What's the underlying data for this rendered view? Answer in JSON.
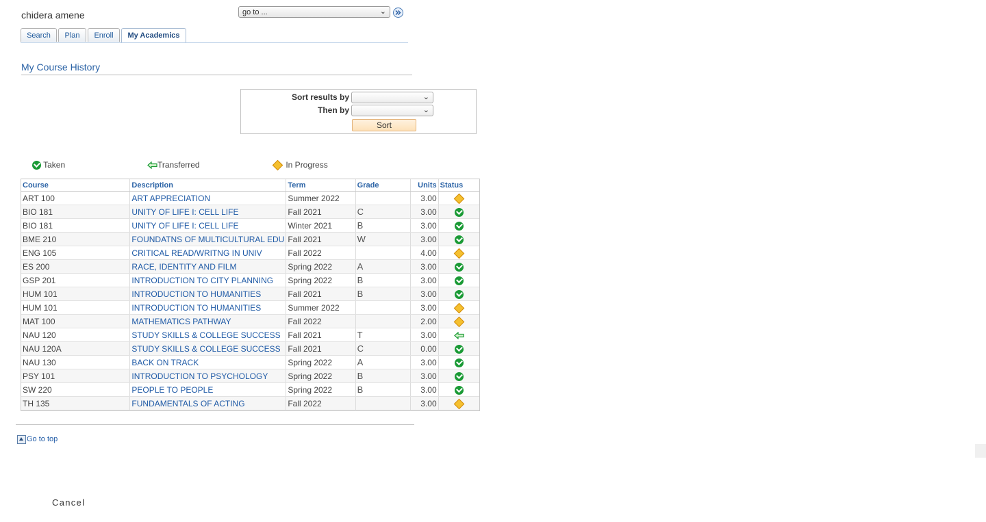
{
  "header": {
    "student_name": "chidera amene",
    "goto_select": "go to ..."
  },
  "tabs": [
    {
      "label": "Search",
      "active": false
    },
    {
      "label": "Plan",
      "active": false
    },
    {
      "label": "Enroll",
      "active": false
    },
    {
      "label": "My Academics",
      "active": true
    }
  ],
  "page_title": "My Course History",
  "sort": {
    "sort_label": "Sort results by",
    "then_label": "Then by",
    "sort_value": "",
    "then_value": "",
    "button_label": "Sort"
  },
  "legend": {
    "taken": "Taken",
    "transferred": "Transferred",
    "in_progress": "In Progress"
  },
  "table": {
    "headers": {
      "course": "Course",
      "description": "Description",
      "term": "Term",
      "grade": "Grade",
      "units": "Units",
      "status": "Status"
    },
    "rows": [
      {
        "course": "ART 100",
        "description": "ART APPRECIATION",
        "term": "Summer 2022",
        "grade": "",
        "units": "3.00",
        "status": "in-progress"
      },
      {
        "course": "BIO 181",
        "description": "UNITY OF LIFE I: CELL LIFE",
        "term": "Fall 2021",
        "grade": "C",
        "units": "3.00",
        "status": "taken"
      },
      {
        "course": "BIO 181",
        "description": "UNITY OF LIFE I: CELL LIFE",
        "term": "Winter 2021",
        "grade": "B",
        "units": "3.00",
        "status": "taken"
      },
      {
        "course": "BME 210",
        "description": "FOUNDATNS OF MULTICULTURAL EDU",
        "term": "Fall 2021",
        "grade": "W",
        "units": "3.00",
        "status": "taken"
      },
      {
        "course": "ENG 105",
        "description": "CRITICAL READ/WRITNG IN UNIV",
        "term": "Fall 2022",
        "grade": "",
        "units": "4.00",
        "status": "in-progress"
      },
      {
        "course": "ES 200",
        "description": "RACE, IDENTITY AND FILM",
        "term": "Spring 2022",
        "grade": "A",
        "units": "3.00",
        "status": "taken"
      },
      {
        "course": "GSP 201",
        "description": "INTRODUCTION TO CITY PLANNING",
        "term": "Spring 2022",
        "grade": "B",
        "units": "3.00",
        "status": "taken"
      },
      {
        "course": "HUM 101",
        "description": "INTRODUCTION TO HUMANITIES",
        "term": "Fall 2021",
        "grade": "B",
        "units": "3.00",
        "status": "taken"
      },
      {
        "course": "HUM 101",
        "description": "INTRODUCTION TO HUMANITIES",
        "term": "Summer 2022",
        "grade": "",
        "units": "3.00",
        "status": "in-progress"
      },
      {
        "course": "MAT 100",
        "description": "MATHEMATICS PATHWAY",
        "term": "Fall 2022",
        "grade": "",
        "units": "2.00",
        "status": "in-progress"
      },
      {
        "course": "NAU 120",
        "description": "STUDY SKILLS & COLLEGE SUCCESS",
        "term": "Fall 2021",
        "grade": "T",
        "units": "3.00",
        "status": "transferred"
      },
      {
        "course": "NAU 120A",
        "description": "STUDY SKILLS & COLLEGE SUCCESS",
        "term": "Fall 2021",
        "grade": "C",
        "units": "0.00",
        "status": "taken"
      },
      {
        "course": "NAU 130",
        "description": "BACK ON TRACK",
        "term": "Spring 2022",
        "grade": "A",
        "units": "3.00",
        "status": "taken"
      },
      {
        "course": "PSY 101",
        "description": "INTRODUCTION TO PSYCHOLOGY",
        "term": "Spring 2022",
        "grade": "B",
        "units": "3.00",
        "status": "taken"
      },
      {
        "course": "SW 220",
        "description": "PEOPLE TO PEOPLE",
        "term": "Spring 2022",
        "grade": "B",
        "units": "3.00",
        "status": "taken"
      },
      {
        "course": "TH 135",
        "description": "FUNDAMENTALS OF ACTING",
        "term": "Fall 2022",
        "grade": "",
        "units": "3.00",
        "status": "in-progress"
      }
    ]
  },
  "footer": {
    "go_top": "Go to top",
    "cancel": "Cancel"
  },
  "colors": {
    "link": "#1f5aa6",
    "taken": "#1a9a35",
    "in_progress": "#f5c02f",
    "sort_button": "#fde1b9"
  }
}
